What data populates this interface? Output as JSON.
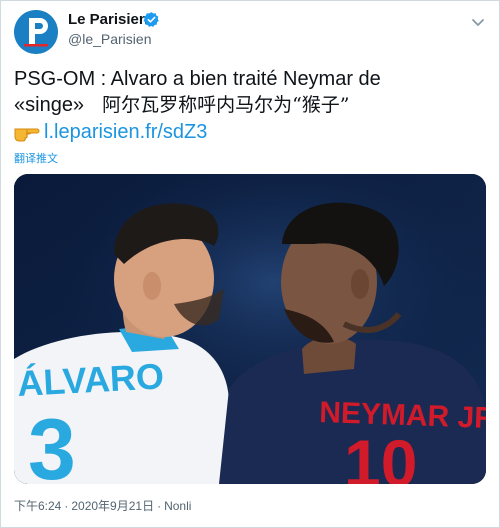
{
  "account": {
    "name": "Le Parisien",
    "handle": "@le_Parisien",
    "avatar_letter": "P"
  },
  "tweet": {
    "line1": "PSG-OM : Alvaro a bien traité Neymar de",
    "line2": "«singe»",
    "line2_chinese": "阿尔瓦罗称呼内马尔为“猴子”",
    "link": "l.leparisien.fr/sdZ3",
    "translate_label": "翻译推文"
  },
  "media": {
    "left_player_shirt": "ÁLVARO",
    "left_player_number": "3",
    "right_player_shirt": "NEYMAR JR",
    "right_player_number": "10"
  },
  "footer": {
    "time": "下午6:24",
    "separator": "·",
    "date": "2020年9月21日",
    "source": "Nonli"
  },
  "colors": {
    "link": "#1b95e0",
    "verified": "#1d9bf0",
    "avatar_bg": "#1b7fc4",
    "psg_navy": "#1b2a52",
    "psg_red": "#d11a2a",
    "om_white": "#f2f4f7",
    "om_blue": "#2aa9e0"
  },
  "icons": {
    "verified": "verified-badge-icon",
    "menu": "chevron-down-icon",
    "hand": "pointing-hand-icon"
  }
}
